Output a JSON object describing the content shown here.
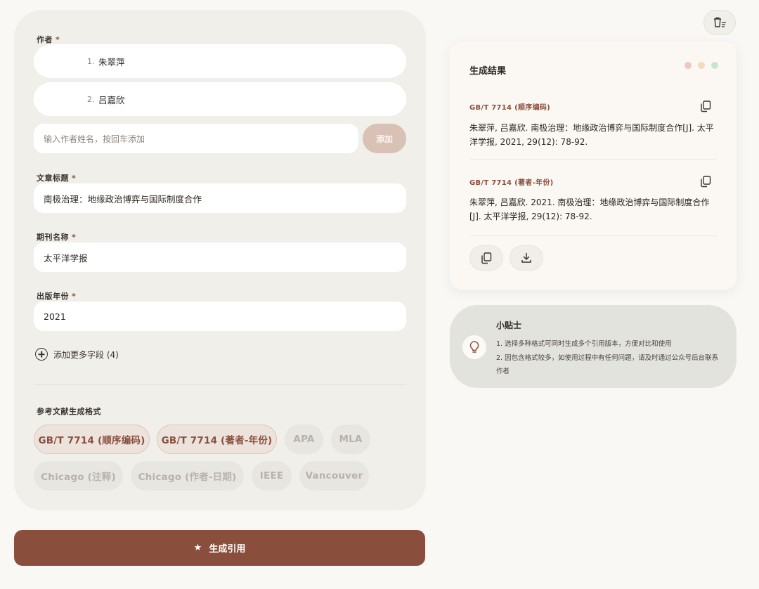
{
  "form": {
    "author_label": "作者",
    "required_mark": "*",
    "authors": [
      {
        "num": "1.",
        "name": "朱翠萍"
      },
      {
        "num": "2.",
        "name": "吕嘉欣"
      }
    ],
    "author_input_placeholder": "输入作者姓名，按回车添加",
    "add_button": "添加",
    "title_label": "文章标题",
    "title_value": "南极治理：地缘政治博弈与国际制度合作",
    "journal_label": "期刊名称",
    "journal_value": "太平洋学报",
    "year_label": "出版年份",
    "year_value": "2021",
    "more_fields": "添加更多字段 (4)",
    "formats_label": "参考文献生成格式",
    "formats": [
      {
        "label": "GB/T 7714 (顺序编码)",
        "active": true
      },
      {
        "label": "GB/T 7714 (著者-年份)",
        "active": true
      },
      {
        "label": "APA",
        "active": false
      },
      {
        "label": "MLA",
        "active": false
      },
      {
        "label": "Chicago (注释)",
        "active": false
      },
      {
        "label": "Chicago (作者-日期)",
        "active": false
      },
      {
        "label": "IEEE",
        "active": false
      },
      {
        "label": "Vancouver",
        "active": false
      }
    ],
    "generate_button": "生成引用"
  },
  "results": {
    "title": "生成结果",
    "dot_colors": [
      "#f2c6c0",
      "#f0dcb6",
      "#c6e4d2"
    ],
    "items": [
      {
        "format": "GB/T 7714 (顺序编码)",
        "text": "朱翠萍, 吕嘉欣. 南极治理：地缘政治博弈与国际制度合作[J]. 太平洋学报, 2021, 29(12): 78-92."
      },
      {
        "format": "GB/T 7714 (著者-年份)",
        "text": "朱翠萍, 吕嘉欣. 2021. 南极治理：地缘政治博弈与国际制度合作[J]. 太平洋学报, 29(12): 78-92."
      }
    ]
  },
  "tips": {
    "title": "小贴士",
    "items": [
      "1. 选择多种格式可同时生成多个引用版本，方便对比和使用",
      "2. 因包含格式较多，如使用过程中有任何问题，请及时通过公众号后台联系作者"
    ]
  },
  "colors": {
    "accent": "#8a4f3c",
    "background": "#f9f8f5",
    "panel": "#f0efea"
  }
}
